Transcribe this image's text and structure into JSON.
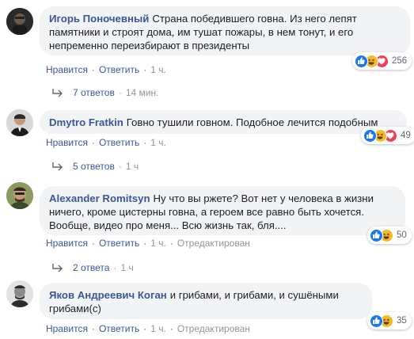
{
  "comments": [
    {
      "author": "Игорь Поночевный",
      "text_l1": "Страна победившего говна. Из него лепят",
      "text_l2": "памятники и строят дома, им тушат пожары, в нем тонут, и его",
      "text_l3": "непременно переизбирают в президенты",
      "like": "Нравится",
      "reply": "Ответить",
      "time": "1 ч.",
      "reactions_count": "256",
      "replies_label": "7 ответов",
      "replies_time": "14 мин."
    },
    {
      "author": "Dmytro Fratkin",
      "text_l1": "Говно тушили говном. Подобное лечится подобным",
      "like": "Нравится",
      "reply": "Ответить",
      "time": "1 ч.",
      "reactions_count": "49",
      "replies_label": "5 ответов",
      "replies_time": "1 ч"
    },
    {
      "author": "Alexander Romitsyn",
      "text_l1": "Ну что вы ржете? Вот нет у человека в жизни",
      "text_l2": "ничего, кроме цистерны говна, а героем все равно быть хочется.",
      "text_l3": "Вообще, видео про меня... Всю жизнь так, бля....",
      "like": "Нравится",
      "reply": "Ответить",
      "time": "1 ч.",
      "edited": "Отредактирован",
      "reactions_count": "50",
      "replies_label": "2 ответа",
      "replies_time": "1 ч"
    },
    {
      "author": "Яков Андреевич Коган",
      "text_l1": "и грибами, и грибами, и сушёными",
      "text_l2": "грибами(с)",
      "like": "Нравится",
      "reply": "Ответить",
      "time": "1 ч.",
      "edited": "Отредактирован",
      "reactions_count": "35"
    }
  ],
  "colors": {
    "link": "#385898",
    "meta": "#90949c",
    "bubble": "#f2f3f5",
    "like_blue": "#1877f2",
    "haha_yellow": "#f7b928",
    "love_red": "#f33e58"
  },
  "icons": [
    "like-reaction-icon",
    "haha-reaction-icon",
    "love-reaction-icon",
    "reply-arrow-icon"
  ]
}
